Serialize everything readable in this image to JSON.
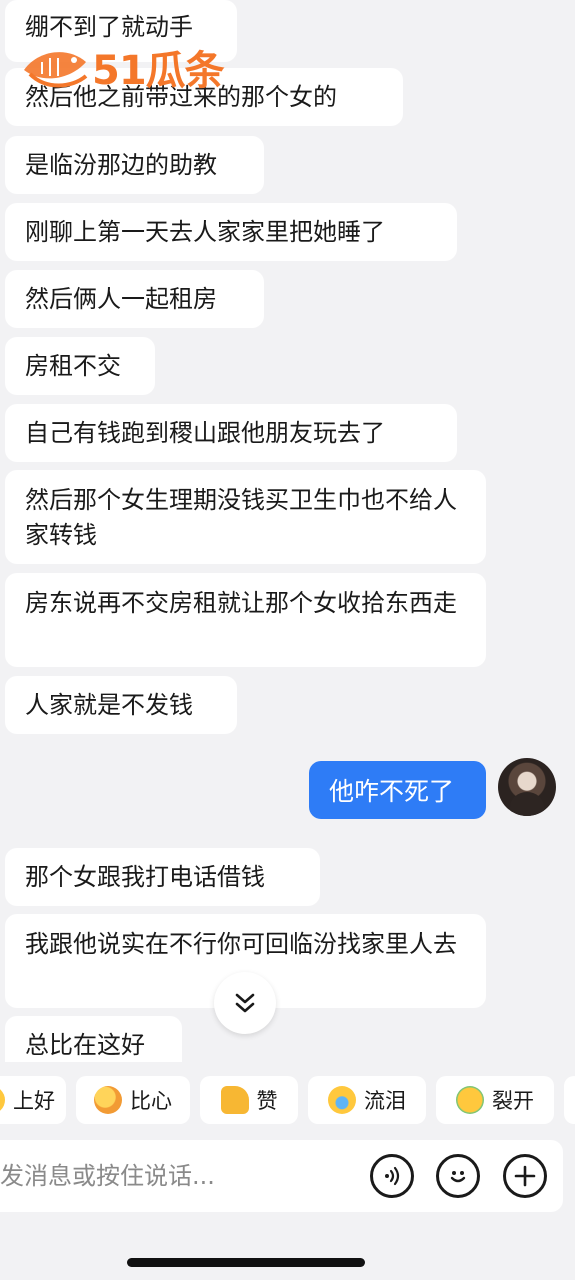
{
  "messages": [
    {
      "text": "绷不到了就动手"
    },
    {
      "text": "然后他之前带过来的那个女的"
    },
    {
      "text": "是临汾那边的助教"
    },
    {
      "text": "刚聊上第一天去人家家里把她睡了"
    },
    {
      "text": "然后俩人一起租房"
    },
    {
      "text": "房租不交"
    },
    {
      "text": "自己有钱跑到稷山跟他朋友玩去了"
    },
    {
      "text": "然后那个女生理期没钱买卫生巾也不给人家转钱"
    },
    {
      "text": "房东说再不交房租就让那个女收拾东西走"
    },
    {
      "text": "人家就是不发钱"
    },
    {
      "text": "他咋不死了"
    },
    {
      "text": "那个女跟我打电话借钱"
    },
    {
      "text": "我跟他说实在不行你可回临汾找家里人去"
    },
    {
      "text": "总比在这好"
    }
  ],
  "watermark": {
    "text": "51瓜条"
  },
  "reactions": [
    {
      "label": "上好",
      "icon": "partial-emoji-icon"
    },
    {
      "label": "比心",
      "icon": "heart-hands-icon"
    },
    {
      "label": "赞",
      "icon": "thumbs-up-icon"
    },
    {
      "label": "流泪",
      "icon": "crying-face-icon"
    },
    {
      "label": "裂开",
      "icon": "cracked-face-icon"
    }
  ],
  "input": {
    "placeholder": "发消息或按住说话..."
  },
  "colors": {
    "accent": "#2e7cf6",
    "background": "#f2f2f4",
    "watermark": "#f4772a"
  }
}
